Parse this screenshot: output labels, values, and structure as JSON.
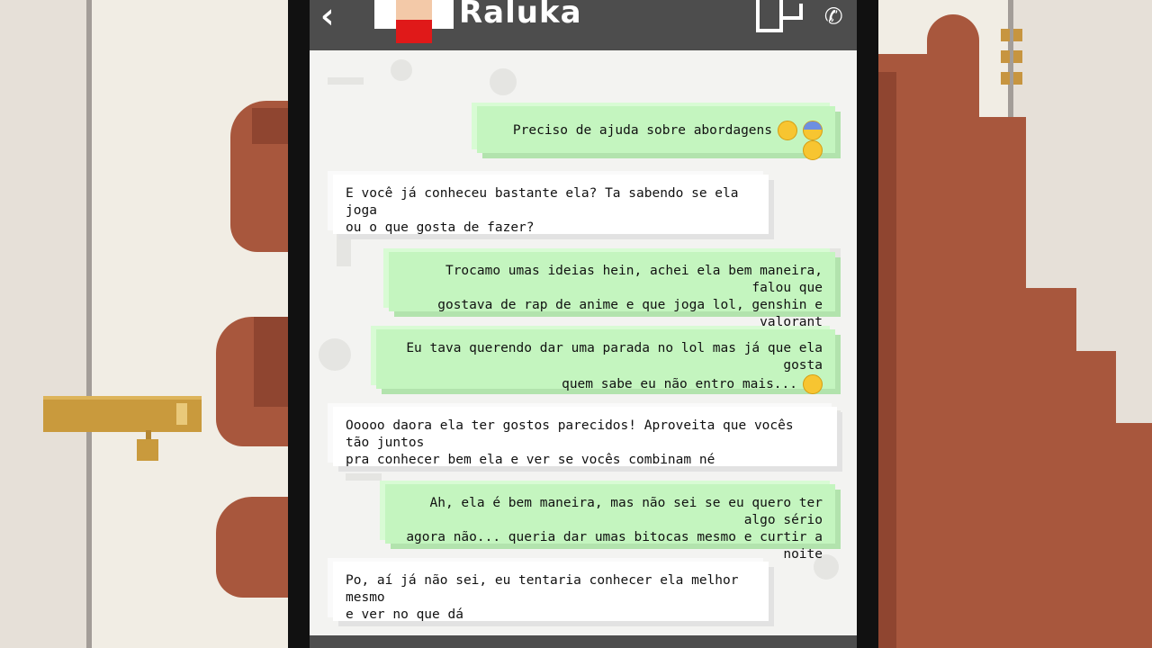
{
  "header": {
    "contact_name": "Raluka",
    "back_icon": "‹",
    "call_icon": "✆"
  },
  "messages": [
    {
      "from": "me",
      "lines": [
        "Preciso de ajuda sobre abordagens"
      ],
      "emojis": [
        "worried-face",
        "screaming-face",
        "hushed-face"
      ]
    },
    {
      "from": "contact",
      "lines": [
        "E você já conheceu bastante ela? Ta sabendo se ela joga",
        "ou o que gosta de fazer?"
      ]
    },
    {
      "from": "me",
      "lines": [
        "Trocamo umas ideias hein, achei ela bem maneira, falou que",
        "gostava de rap de anime e que joga lol, genshin e valorant"
      ]
    },
    {
      "from": "me",
      "lines": [
        "Eu tava querendo dar uma parada no lol mas já que ela gosta",
        "quem sabe eu não entro mais..."
      ],
      "emojis": [
        "squinting-tongue-face"
      ]
    },
    {
      "from": "contact",
      "lines": [
        "Ooooo daora ela ter gostos parecidos! Aproveita que vocês tão juntos",
        "pra conhecer bem ela e ver se vocês combinam né"
      ]
    },
    {
      "from": "me",
      "lines": [
        "Ah, ela é bem maneira, mas não sei se eu quero ter algo sério",
        "agora não... queria dar umas bitocas mesmo e curtir a noite"
      ]
    },
    {
      "from": "contact",
      "lines": [
        "Po, aí já não sei, eu tentaria conhecer ela melhor mesmo",
        "e ver no que dá"
      ]
    }
  ],
  "colors": {
    "sent_bubble": "#c4f5bf",
    "received_bubble": "#ffffff",
    "header": "#4d4d4d",
    "phone_frame": "#111111",
    "skin": "#a8573d"
  }
}
